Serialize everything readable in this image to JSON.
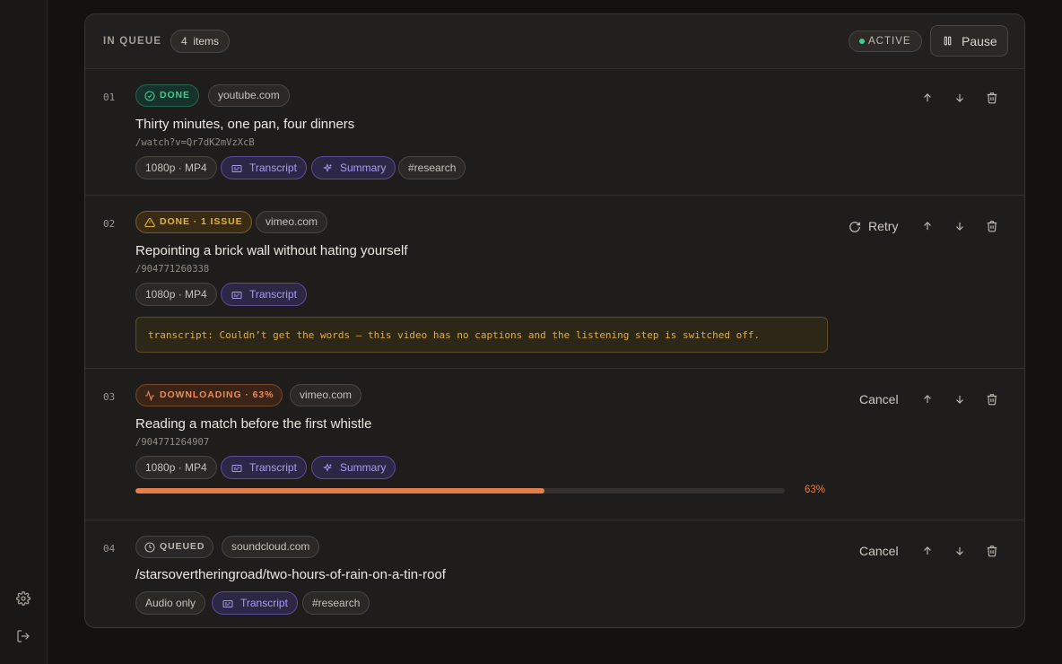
{
  "header": {
    "title": "IN QUEUE",
    "count": "4",
    "count_label": "items",
    "active_label": "ACTIVE",
    "pause_label": "Pause"
  },
  "sidebar": {
    "icons": [
      "gear-icon",
      "logout-icon"
    ]
  },
  "colors": {
    "done": "#45c993",
    "warning": "#e6b23a",
    "downloading": "#e88a58",
    "accent_violet": "#a99bf0",
    "active_dot": "#3fcf8e"
  },
  "rows": [
    {
      "num": "01",
      "status": "DONE",
      "status_icon": "check-circle-icon",
      "domain": "youtube.com",
      "title": "Thirty minutes, one pan, four dinners",
      "path": "/watch?v=Qr7dK2mVzXcB",
      "chips": [
        "1080p · MP4",
        "Transcript",
        "Summary",
        "#research"
      ]
    },
    {
      "num": "02",
      "status": "DONE · 1 ISSUE",
      "status_icon": "warning-triangle-icon",
      "domain": "vimeo.com",
      "title": "Repointing a brick wall without hating yourself",
      "path": "/904771260338",
      "chips": [
        "1080p · MP4",
        "Transcript"
      ],
      "retry_label": "Retry",
      "error": "transcript: Couldn’t get the words — this video has no captions and the listening step is switched off."
    },
    {
      "num": "03",
      "status": "DOWNLOADING · 63%",
      "status_icon": "activity-icon",
      "domain": "vimeo.com",
      "title": "Reading a match before the first whistle",
      "path": "/904771264907",
      "chips": [
        "1080p · MP4",
        "Transcript",
        "Summary"
      ],
      "cancel_label": "Cancel",
      "progress": 0.63,
      "progress_label": "63%"
    },
    {
      "num": "04",
      "status": "QUEUED",
      "status_icon": "clock-icon",
      "domain": "soundcloud.com",
      "title": "/starsovertheringroad/two-hours-of-rain-on-a-tin-roof",
      "chips": [
        "Audio only",
        "Transcript",
        "#research"
      ],
      "cancel_label": "Cancel"
    }
  ]
}
